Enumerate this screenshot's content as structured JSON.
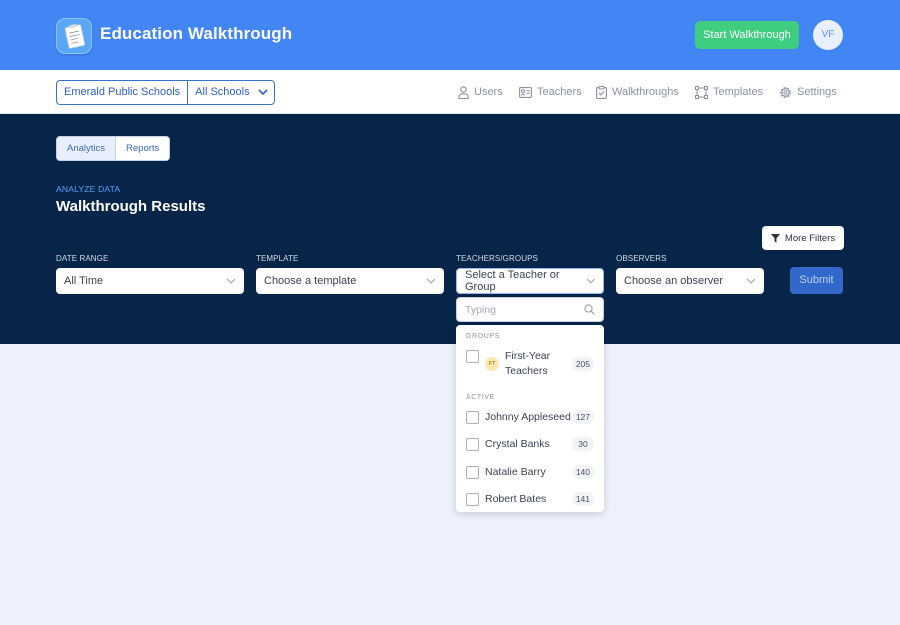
{
  "header": {
    "app_title": "Education Walkthrough",
    "start_button": "Start Walkthrough",
    "avatar_initials": "VF",
    "brand_color": "#4285f4",
    "start_color": "#3fce7f"
  },
  "nav": {
    "district": "Emerald Public Schools",
    "school": "All Schools",
    "items": [
      {
        "label": "Users",
        "icon": "user-icon"
      },
      {
        "label": "Teachers",
        "icon": "id-card-icon"
      },
      {
        "label": "Walkthroughs",
        "icon": "clipboard-icon"
      },
      {
        "label": "Templates",
        "icon": "template-icon"
      },
      {
        "label": "Settings",
        "icon": "gear-icon"
      }
    ]
  },
  "main": {
    "tabs": [
      "Analytics",
      "Reports"
    ],
    "active_tab": "Analytics",
    "eyebrow": "ANALYZE DATA",
    "title": "Walkthrough Results",
    "more_filters": "More Filters",
    "submit": "Submit",
    "filters": {
      "date_range": {
        "label": "DATE RANGE",
        "value": "All Time"
      },
      "template": {
        "label": "TEMPLATE",
        "value": "Choose a template"
      },
      "teachers": {
        "label": "TEACHERS/GROUPS",
        "value": "Select a Teacher or Group"
      },
      "observers": {
        "label": "OBSERVERS",
        "value": "Choose an observer"
      }
    },
    "hero_color": "#062548"
  },
  "dropdown": {
    "search_placeholder": "Typing",
    "groups_label": "GROUPS",
    "groups": [
      {
        "chip": "FT",
        "name_line1": "First-Year",
        "name_line2": "Teachers",
        "count": "205"
      }
    ],
    "active_label": "ACTIVE",
    "active": [
      {
        "name": "Johnny Appleseed",
        "count": "127"
      },
      {
        "name": "Crystal Banks",
        "count": "30"
      },
      {
        "name": "Natalie Barry",
        "count": "140"
      },
      {
        "name": "Robert Bates",
        "count": "141"
      }
    ]
  }
}
